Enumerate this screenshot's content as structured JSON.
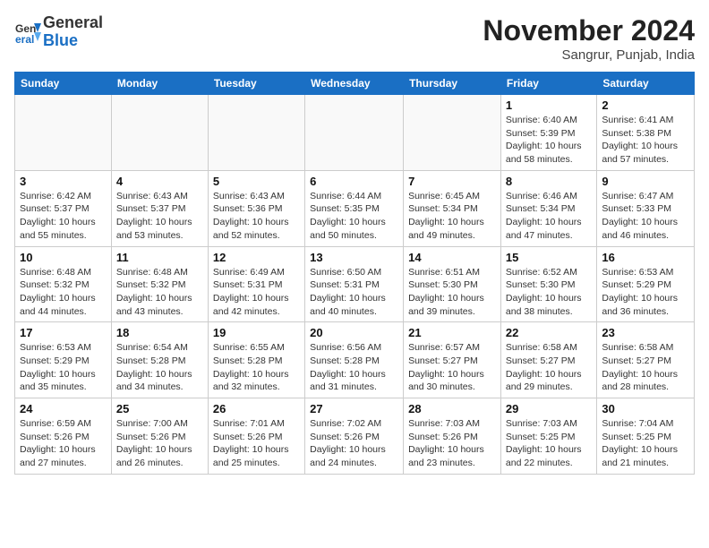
{
  "header": {
    "logo_line1": "General",
    "logo_line2": "Blue",
    "month_title": "November 2024",
    "location": "Sangrur, Punjab, India"
  },
  "weekdays": [
    "Sunday",
    "Monday",
    "Tuesday",
    "Wednesday",
    "Thursday",
    "Friday",
    "Saturday"
  ],
  "weeks": [
    [
      {
        "day": "",
        "info": "",
        "empty": true
      },
      {
        "day": "",
        "info": "",
        "empty": true
      },
      {
        "day": "",
        "info": "",
        "empty": true
      },
      {
        "day": "",
        "info": "",
        "empty": true
      },
      {
        "day": "",
        "info": "",
        "empty": true
      },
      {
        "day": "1",
        "info": "Sunrise: 6:40 AM\nSunset: 5:39 PM\nDaylight: 10 hours\nand 58 minutes.",
        "empty": false
      },
      {
        "day": "2",
        "info": "Sunrise: 6:41 AM\nSunset: 5:38 PM\nDaylight: 10 hours\nand 57 minutes.",
        "empty": false
      }
    ],
    [
      {
        "day": "3",
        "info": "Sunrise: 6:42 AM\nSunset: 5:37 PM\nDaylight: 10 hours\nand 55 minutes.",
        "empty": false
      },
      {
        "day": "4",
        "info": "Sunrise: 6:43 AM\nSunset: 5:37 PM\nDaylight: 10 hours\nand 53 minutes.",
        "empty": false
      },
      {
        "day": "5",
        "info": "Sunrise: 6:43 AM\nSunset: 5:36 PM\nDaylight: 10 hours\nand 52 minutes.",
        "empty": false
      },
      {
        "day": "6",
        "info": "Sunrise: 6:44 AM\nSunset: 5:35 PM\nDaylight: 10 hours\nand 50 minutes.",
        "empty": false
      },
      {
        "day": "7",
        "info": "Sunrise: 6:45 AM\nSunset: 5:34 PM\nDaylight: 10 hours\nand 49 minutes.",
        "empty": false
      },
      {
        "day": "8",
        "info": "Sunrise: 6:46 AM\nSunset: 5:34 PM\nDaylight: 10 hours\nand 47 minutes.",
        "empty": false
      },
      {
        "day": "9",
        "info": "Sunrise: 6:47 AM\nSunset: 5:33 PM\nDaylight: 10 hours\nand 46 minutes.",
        "empty": false
      }
    ],
    [
      {
        "day": "10",
        "info": "Sunrise: 6:48 AM\nSunset: 5:32 PM\nDaylight: 10 hours\nand 44 minutes.",
        "empty": false
      },
      {
        "day": "11",
        "info": "Sunrise: 6:48 AM\nSunset: 5:32 PM\nDaylight: 10 hours\nand 43 minutes.",
        "empty": false
      },
      {
        "day": "12",
        "info": "Sunrise: 6:49 AM\nSunset: 5:31 PM\nDaylight: 10 hours\nand 42 minutes.",
        "empty": false
      },
      {
        "day": "13",
        "info": "Sunrise: 6:50 AM\nSunset: 5:31 PM\nDaylight: 10 hours\nand 40 minutes.",
        "empty": false
      },
      {
        "day": "14",
        "info": "Sunrise: 6:51 AM\nSunset: 5:30 PM\nDaylight: 10 hours\nand 39 minutes.",
        "empty": false
      },
      {
        "day": "15",
        "info": "Sunrise: 6:52 AM\nSunset: 5:30 PM\nDaylight: 10 hours\nand 38 minutes.",
        "empty": false
      },
      {
        "day": "16",
        "info": "Sunrise: 6:53 AM\nSunset: 5:29 PM\nDaylight: 10 hours\nand 36 minutes.",
        "empty": false
      }
    ],
    [
      {
        "day": "17",
        "info": "Sunrise: 6:53 AM\nSunset: 5:29 PM\nDaylight: 10 hours\nand 35 minutes.",
        "empty": false
      },
      {
        "day": "18",
        "info": "Sunrise: 6:54 AM\nSunset: 5:28 PM\nDaylight: 10 hours\nand 34 minutes.",
        "empty": false
      },
      {
        "day": "19",
        "info": "Sunrise: 6:55 AM\nSunset: 5:28 PM\nDaylight: 10 hours\nand 32 minutes.",
        "empty": false
      },
      {
        "day": "20",
        "info": "Sunrise: 6:56 AM\nSunset: 5:28 PM\nDaylight: 10 hours\nand 31 minutes.",
        "empty": false
      },
      {
        "day": "21",
        "info": "Sunrise: 6:57 AM\nSunset: 5:27 PM\nDaylight: 10 hours\nand 30 minutes.",
        "empty": false
      },
      {
        "day": "22",
        "info": "Sunrise: 6:58 AM\nSunset: 5:27 PM\nDaylight: 10 hours\nand 29 minutes.",
        "empty": false
      },
      {
        "day": "23",
        "info": "Sunrise: 6:58 AM\nSunset: 5:27 PM\nDaylight: 10 hours\nand 28 minutes.",
        "empty": false
      }
    ],
    [
      {
        "day": "24",
        "info": "Sunrise: 6:59 AM\nSunset: 5:26 PM\nDaylight: 10 hours\nand 27 minutes.",
        "empty": false
      },
      {
        "day": "25",
        "info": "Sunrise: 7:00 AM\nSunset: 5:26 PM\nDaylight: 10 hours\nand 26 minutes.",
        "empty": false
      },
      {
        "day": "26",
        "info": "Sunrise: 7:01 AM\nSunset: 5:26 PM\nDaylight: 10 hours\nand 25 minutes.",
        "empty": false
      },
      {
        "day": "27",
        "info": "Sunrise: 7:02 AM\nSunset: 5:26 PM\nDaylight: 10 hours\nand 24 minutes.",
        "empty": false
      },
      {
        "day": "28",
        "info": "Sunrise: 7:03 AM\nSunset: 5:26 PM\nDaylight: 10 hours\nand 23 minutes.",
        "empty": false
      },
      {
        "day": "29",
        "info": "Sunrise: 7:03 AM\nSunset: 5:25 PM\nDaylight: 10 hours\nand 22 minutes.",
        "empty": false
      },
      {
        "day": "30",
        "info": "Sunrise: 7:04 AM\nSunset: 5:25 PM\nDaylight: 10 hours\nand 21 minutes.",
        "empty": false
      }
    ]
  ]
}
